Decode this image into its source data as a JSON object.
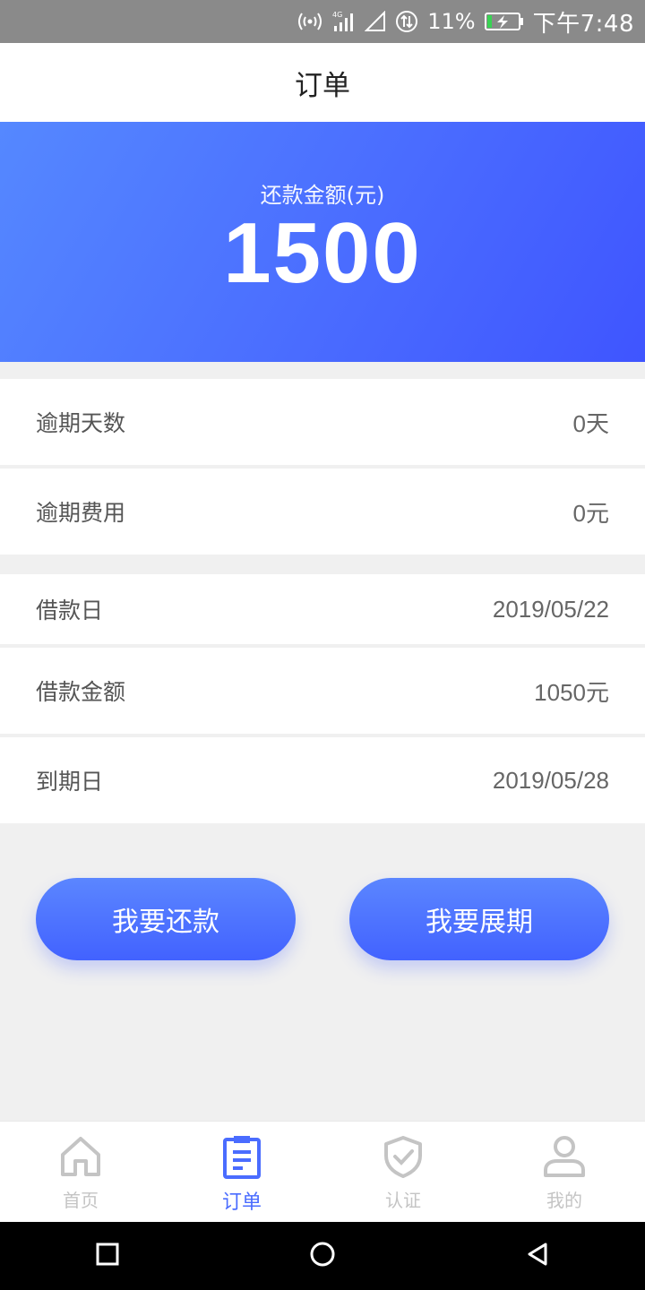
{
  "status_bar": {
    "battery_percent": "11%",
    "time": "下午7:48",
    "icons": [
      "hotspot-icon",
      "signal-4g-icon",
      "signal-empty-icon",
      "data-sync-icon",
      "battery-charging-icon"
    ]
  },
  "header": {
    "title": "订单"
  },
  "summary": {
    "label": "还款金额(元)",
    "amount": "1500"
  },
  "details": [
    {
      "label": "逾期天数",
      "value": "0天"
    },
    {
      "label": "逾期费用",
      "value": "0元"
    },
    {
      "label": "借款日",
      "value": "2019/05/22"
    },
    {
      "label": "借款金额",
      "value": "1050元"
    },
    {
      "label": "到期日",
      "value": "2019/05/28"
    }
  ],
  "actions": {
    "repay_label": "我要还款",
    "extend_label": "我要展期"
  },
  "tab_bar": {
    "items": [
      {
        "label": "首页",
        "icon": "home-icon",
        "active": false
      },
      {
        "label": "订单",
        "icon": "order-clipboard-icon",
        "active": true
      },
      {
        "label": "认证",
        "icon": "shield-check-icon",
        "active": false
      },
      {
        "label": "我的",
        "icon": "user-icon",
        "active": false
      }
    ]
  },
  "colors": {
    "accent": "#4a6cff",
    "inactive": "#c4c4c4",
    "status_bar": "#8a8a8a"
  }
}
